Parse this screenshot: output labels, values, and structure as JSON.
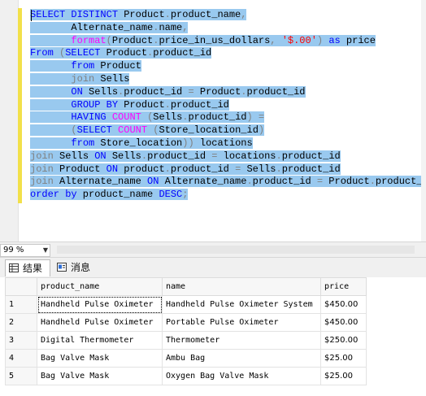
{
  "editor": {
    "lines": [
      [
        {
          "t": "SELECT DISTINCT",
          "c": "kw"
        },
        {
          "t": " Product",
          "c": "tx"
        },
        {
          "t": ".",
          "c": "gy"
        },
        {
          "t": "product_name",
          "c": "tx"
        },
        {
          "t": ",",
          "c": "gy"
        }
      ],
      [
        {
          "t": "       Alternate_name",
          "c": "tx"
        },
        {
          "t": ".",
          "c": "gy"
        },
        {
          "t": "name",
          "c": "tx"
        },
        {
          "t": ",",
          "c": "gy"
        }
      ],
      [
        {
          "t": "       ",
          "c": "tx"
        },
        {
          "t": "format",
          "c": "fn"
        },
        {
          "t": "(",
          "c": "gy"
        },
        {
          "t": "Product",
          "c": "tx"
        },
        {
          "t": ".",
          "c": "gy"
        },
        {
          "t": "price_in_us_dollars",
          "c": "tx"
        },
        {
          "t": ",",
          "c": "gy"
        },
        {
          "t": " ",
          "c": "tx"
        },
        {
          "t": "'$.00'",
          "c": "st"
        },
        {
          "t": ")",
          "c": "gy"
        },
        {
          "t": " ",
          "c": "tx"
        },
        {
          "t": "as",
          "c": "kw"
        },
        {
          "t": " price",
          "c": "tx"
        }
      ],
      [
        {
          "t": "From",
          "c": "kw"
        },
        {
          "t": " ",
          "c": "tx"
        },
        {
          "t": "(",
          "c": "gy"
        },
        {
          "t": "SELECT",
          "c": "kw"
        },
        {
          "t": " Product",
          "c": "tx"
        },
        {
          "t": ".",
          "c": "gy"
        },
        {
          "t": "product_id",
          "c": "tx"
        }
      ],
      [
        {
          "t": "       ",
          "c": "tx"
        },
        {
          "t": "from",
          "c": "kw"
        },
        {
          "t": " Product",
          "c": "tx"
        }
      ],
      [
        {
          "t": "       ",
          "c": "tx"
        },
        {
          "t": "join",
          "c": "gy"
        },
        {
          "t": " Sells",
          "c": "tx"
        }
      ],
      [
        {
          "t": "       ",
          "c": "tx"
        },
        {
          "t": "ON",
          "c": "kw"
        },
        {
          "t": " Sells",
          "c": "tx"
        },
        {
          "t": ".",
          "c": "gy"
        },
        {
          "t": "product_id ",
          "c": "tx"
        },
        {
          "t": "=",
          "c": "gy"
        },
        {
          "t": " Product",
          "c": "tx"
        },
        {
          "t": ".",
          "c": "gy"
        },
        {
          "t": "product_id",
          "c": "tx"
        }
      ],
      [
        {
          "t": "       ",
          "c": "tx"
        },
        {
          "t": "GROUP BY",
          "c": "kw"
        },
        {
          "t": " Product",
          "c": "tx"
        },
        {
          "t": ".",
          "c": "gy"
        },
        {
          "t": "product_id",
          "c": "tx"
        }
      ],
      [
        {
          "t": "       ",
          "c": "tx"
        },
        {
          "t": "HAVING",
          "c": "kw"
        },
        {
          "t": " ",
          "c": "tx"
        },
        {
          "t": "COUNT",
          "c": "fn"
        },
        {
          "t": " ",
          "c": "tx"
        },
        {
          "t": "(",
          "c": "gy"
        },
        {
          "t": "Sells",
          "c": "tx"
        },
        {
          "t": ".",
          "c": "gy"
        },
        {
          "t": "product_id",
          "c": "tx"
        },
        {
          "t": ")",
          "c": "gy"
        },
        {
          "t": " ",
          "c": "tx"
        },
        {
          "t": "=",
          "c": "gy"
        }
      ],
      [
        {
          "t": "       ",
          "c": "tx"
        },
        {
          "t": "(",
          "c": "gy"
        },
        {
          "t": "SELECT",
          "c": "kw"
        },
        {
          "t": " ",
          "c": "tx"
        },
        {
          "t": "COUNT",
          "c": "fn"
        },
        {
          "t": " ",
          "c": "tx"
        },
        {
          "t": "(",
          "c": "gy"
        },
        {
          "t": "Store_location_id",
          "c": "tx"
        },
        {
          "t": ")",
          "c": "gy"
        }
      ],
      [
        {
          "t": "       ",
          "c": "tx"
        },
        {
          "t": "from",
          "c": "kw"
        },
        {
          "t": " Store_location",
          "c": "tx"
        },
        {
          "t": "))",
          "c": "gy"
        },
        {
          "t": " locations",
          "c": "tx"
        }
      ],
      [
        {
          "t": "join",
          "c": "gy"
        },
        {
          "t": " Sells ",
          "c": "tx"
        },
        {
          "t": "ON",
          "c": "kw"
        },
        {
          "t": " Sells",
          "c": "tx"
        },
        {
          "t": ".",
          "c": "gy"
        },
        {
          "t": "product_id ",
          "c": "tx"
        },
        {
          "t": "=",
          "c": "gy"
        },
        {
          "t": " locations",
          "c": "tx"
        },
        {
          "t": ".",
          "c": "gy"
        },
        {
          "t": "product_id",
          "c": "tx"
        }
      ],
      [
        {
          "t": "join",
          "c": "gy"
        },
        {
          "t": " Product ",
          "c": "tx"
        },
        {
          "t": "ON",
          "c": "kw"
        },
        {
          "t": " product",
          "c": "tx"
        },
        {
          "t": ".",
          "c": "gy"
        },
        {
          "t": "product_id ",
          "c": "tx"
        },
        {
          "t": "=",
          "c": "gy"
        },
        {
          "t": " Sells",
          "c": "tx"
        },
        {
          "t": ".",
          "c": "gy"
        },
        {
          "t": "product_id",
          "c": "tx"
        }
      ],
      [
        {
          "t": "join",
          "c": "gy"
        },
        {
          "t": " Alternate_name ",
          "c": "tx"
        },
        {
          "t": "ON",
          "c": "kw"
        },
        {
          "t": " Alternate_name",
          "c": "tx"
        },
        {
          "t": ".",
          "c": "gy"
        },
        {
          "t": "product_id ",
          "c": "tx"
        },
        {
          "t": "=",
          "c": "gy"
        },
        {
          "t": " Product",
          "c": "tx"
        },
        {
          "t": ".",
          "c": "gy"
        },
        {
          "t": "product_id",
          "c": "tx"
        }
      ],
      [
        {
          "t": "order by",
          "c": "kw"
        },
        {
          "t": " product_name ",
          "c": "tx"
        },
        {
          "t": "DESC",
          "c": "kw"
        },
        {
          "t": ";",
          "c": "gy"
        }
      ]
    ]
  },
  "zoom": {
    "value": "99 %",
    "arrow": "▼"
  },
  "tabs": {
    "results": "结果",
    "messages": "消息"
  },
  "grid": {
    "columns": [
      "product_name",
      "name",
      "price"
    ],
    "rows": [
      {
        "n": "1",
        "product_name": "Handheld Pulse Oximeter",
        "name": "Handheld Pulse Oximeter System",
        "price": "$450.00"
      },
      {
        "n": "2",
        "product_name": "Handheld Pulse Oximeter",
        "name": "Portable Pulse Oximeter",
        "price": "$450.00"
      },
      {
        "n": "3",
        "product_name": "Digital Thermometer",
        "name": "Thermometer",
        "price": "$250.00"
      },
      {
        "n": "4",
        "product_name": "Bag Valve Mask",
        "name": "Ambu Bag",
        "price": "$25.00"
      },
      {
        "n": "5",
        "product_name": "Bag Valve Mask",
        "name": "Oxygen Bag Valve Mask",
        "price": "$25.00"
      }
    ]
  },
  "colors": {
    "selection": "#99c9ef",
    "keyword": "#0000ff",
    "function": "#ff00ff",
    "operator": "#808080",
    "string": "#ff0000",
    "changebar": "#f2e04a"
  }
}
